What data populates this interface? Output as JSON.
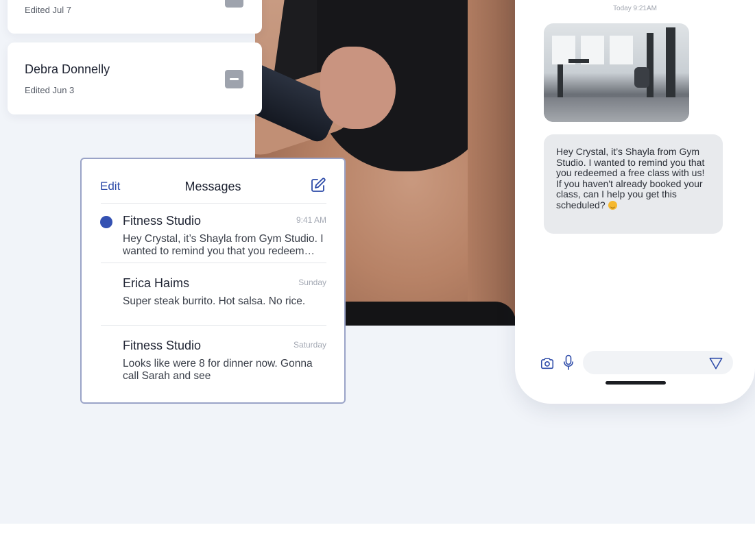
{
  "notes": {
    "cards": [
      {
        "title": "",
        "subtitle": "Edited Jul 7"
      },
      {
        "title": "Debra Donnelly",
        "subtitle": "Edited Jun 3"
      }
    ]
  },
  "messages": {
    "edit_label": "Edit",
    "title": "Messages",
    "threads": [
      {
        "sender": "Fitness Studio",
        "time": "9:41 AM",
        "preview": "Hey Crystal, it’s Shayla from Gym Studio. I wanted to remind you that you redeem…",
        "unread": true
      },
      {
        "sender": "Erica Haims",
        "time": "Sunday",
        "preview": "Super steak burrito. Hot salsa. No rice.",
        "unread": false
      },
      {
        "sender": "Fitness Studio",
        "time": "Saturday",
        "preview": "Looks like were 8 for dinner now. Gonna call Sarah and see",
        "unread": false
      }
    ]
  },
  "chat": {
    "timestamp": "Today 9:21AM",
    "message": "Hey Crystal, it’s Shayla from Gym Studio. I wanted to remind you that you redeemed a free class with us! If you haven't already booked your class, can I help you get this scheduled?",
    "input_value": "",
    "input_placeholder": ""
  },
  "icons": {
    "compose": "compose-icon",
    "camera": "camera-icon",
    "microphone": "microphone-icon",
    "send": "send-icon",
    "note": "note-icon"
  },
  "colors": {
    "accent": "#2c4aa8",
    "unread_dot": "#3451b2",
    "panel_border": "#9aa3c7",
    "section_bg": "#f1f4f9",
    "bubble_bg": "#e8eaed"
  }
}
